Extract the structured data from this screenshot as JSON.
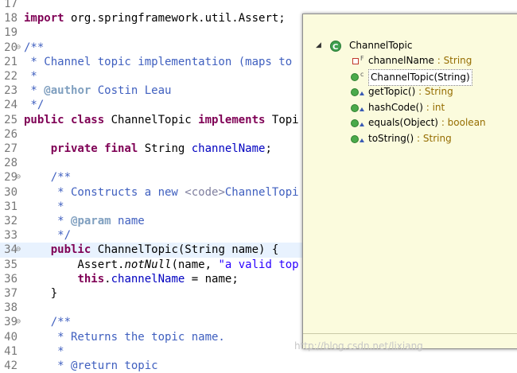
{
  "editor": {
    "lines": [
      {
        "num": "17",
        "fold": "",
        "segments": []
      },
      {
        "num": "18",
        "fold": "",
        "segments": [
          {
            "t": "import",
            "c": "kw"
          },
          {
            "t": " org.springframework.util.Assert;",
            "c": ""
          }
        ]
      },
      {
        "num": "19",
        "fold": "",
        "segments": []
      },
      {
        "num": "20",
        "fold": "⊖",
        "segments": [
          {
            "t": "/**",
            "c": "cm"
          }
        ]
      },
      {
        "num": "21",
        "fold": "",
        "segments": [
          {
            "t": " * Channel topic implementation (maps to",
            "c": "cm"
          }
        ]
      },
      {
        "num": "22",
        "fold": "",
        "segments": [
          {
            "t": " *",
            "c": "cm"
          }
        ]
      },
      {
        "num": "23",
        "fold": "",
        "segments": [
          {
            "t": " * ",
            "c": "cm"
          },
          {
            "t": "@author",
            "c": "at"
          },
          {
            "t": " Costin Leau",
            "c": "cm"
          }
        ]
      },
      {
        "num": "24",
        "fold": "",
        "segments": [
          {
            "t": " */",
            "c": "cm"
          }
        ]
      },
      {
        "num": "25",
        "fold": "",
        "segments": [
          {
            "t": "public class",
            "c": "kw"
          },
          {
            "t": " ChannelTopic ",
            "c": ""
          },
          {
            "t": "implements",
            "c": "kw"
          },
          {
            "t": " Topi",
            "c": ""
          }
        ]
      },
      {
        "num": "26",
        "fold": "",
        "segments": []
      },
      {
        "num": "27",
        "fold": "",
        "segments": [
          {
            "t": "    ",
            "c": ""
          },
          {
            "t": "private final",
            "c": "kw"
          },
          {
            "t": " String ",
            "c": ""
          },
          {
            "t": "channelName",
            "c": "fld"
          },
          {
            "t": ";",
            "c": ""
          }
        ]
      },
      {
        "num": "28",
        "fold": "",
        "segments": []
      },
      {
        "num": "29",
        "fold": "⊖",
        "segments": [
          {
            "t": "    /**",
            "c": "cm"
          }
        ]
      },
      {
        "num": "30",
        "fold": "",
        "segments": [
          {
            "t": "     * Constructs a new ",
            "c": "cm"
          },
          {
            "t": "<code>",
            "c": "tag"
          },
          {
            "t": "ChannelTopi",
            "c": "cm"
          }
        ]
      },
      {
        "num": "31",
        "fold": "",
        "segments": [
          {
            "t": "     *",
            "c": "cm"
          }
        ]
      },
      {
        "num": "32",
        "fold": "",
        "segments": [
          {
            "t": "     * ",
            "c": "cm"
          },
          {
            "t": "@param",
            "c": "at"
          },
          {
            "t": " name",
            "c": "cm"
          }
        ]
      },
      {
        "num": "33",
        "fold": "",
        "segments": [
          {
            "t": "     */",
            "c": "cm"
          }
        ]
      },
      {
        "num": "34",
        "fold": "⊖",
        "hl": true,
        "segments": [
          {
            "t": "    ",
            "c": ""
          },
          {
            "t": "public",
            "c": "kw"
          },
          {
            "t": " ChannelTopic(String name) {",
            "c": ""
          }
        ]
      },
      {
        "num": "35",
        "fold": "",
        "segments": [
          {
            "t": "        Assert.",
            "c": ""
          },
          {
            "t": "notNull",
            "c": "it"
          },
          {
            "t": "(name, ",
            "c": ""
          },
          {
            "t": "\"a valid top",
            "c": "str"
          }
        ]
      },
      {
        "num": "36",
        "fold": "",
        "segments": [
          {
            "t": "        ",
            "c": ""
          },
          {
            "t": "this",
            "c": "kw"
          },
          {
            "t": ".",
            "c": ""
          },
          {
            "t": "channelName",
            "c": "fld"
          },
          {
            "t": " = name;",
            "c": ""
          }
        ]
      },
      {
        "num": "37",
        "fold": "",
        "segments": [
          {
            "t": "    }",
            "c": ""
          }
        ]
      },
      {
        "num": "38",
        "fold": "",
        "segments": []
      },
      {
        "num": "39",
        "fold": "⊖",
        "segments": [
          {
            "t": "    /**",
            "c": "cm"
          }
        ]
      },
      {
        "num": "40",
        "fold": "",
        "segments": [
          {
            "t": "     * Returns the topic name.",
            "c": "cm"
          }
        ]
      },
      {
        "num": "41",
        "fold": "",
        "segments": [
          {
            "t": "     *",
            "c": "cm"
          }
        ]
      },
      {
        "num": "42",
        "fold": "",
        "segments": [
          {
            "t": "     * @return topic",
            "c": "cm"
          }
        ]
      }
    ]
  },
  "outline": {
    "class_name": "ChannelTopic",
    "members": [
      {
        "icon": "private-field-icon",
        "kind": "field",
        "sup": "F",
        "name": "channelName",
        "type": " : String",
        "selected": false
      },
      {
        "icon": "constructor-icon",
        "kind": "method",
        "sup": "c",
        "name": "ChannelTopic(String)",
        "type": "",
        "selected": true
      },
      {
        "icon": "public-method-icon",
        "kind": "method",
        "sup": "",
        "name": "getTopic()",
        "type": " : String",
        "selected": false
      },
      {
        "icon": "public-method-icon",
        "kind": "method",
        "sup": "",
        "name": "hashCode()",
        "type": " : int",
        "selected": false
      },
      {
        "icon": "public-method-icon",
        "kind": "method",
        "sup": "",
        "name": "equals(Object)",
        "type": " : boolean",
        "selected": false
      },
      {
        "icon": "public-method-icon",
        "kind": "method",
        "sup": "",
        "name": "toString()",
        "type": " : String",
        "selected": false
      }
    ]
  },
  "watermark": "http://blog.csdn.net/lixiang",
  "colors": {
    "keyword": "#7f0055",
    "comment": "#3f5fbf",
    "field": "#0000c0",
    "string": "#2a00ff",
    "popup_bg": "#fbfbdd"
  }
}
